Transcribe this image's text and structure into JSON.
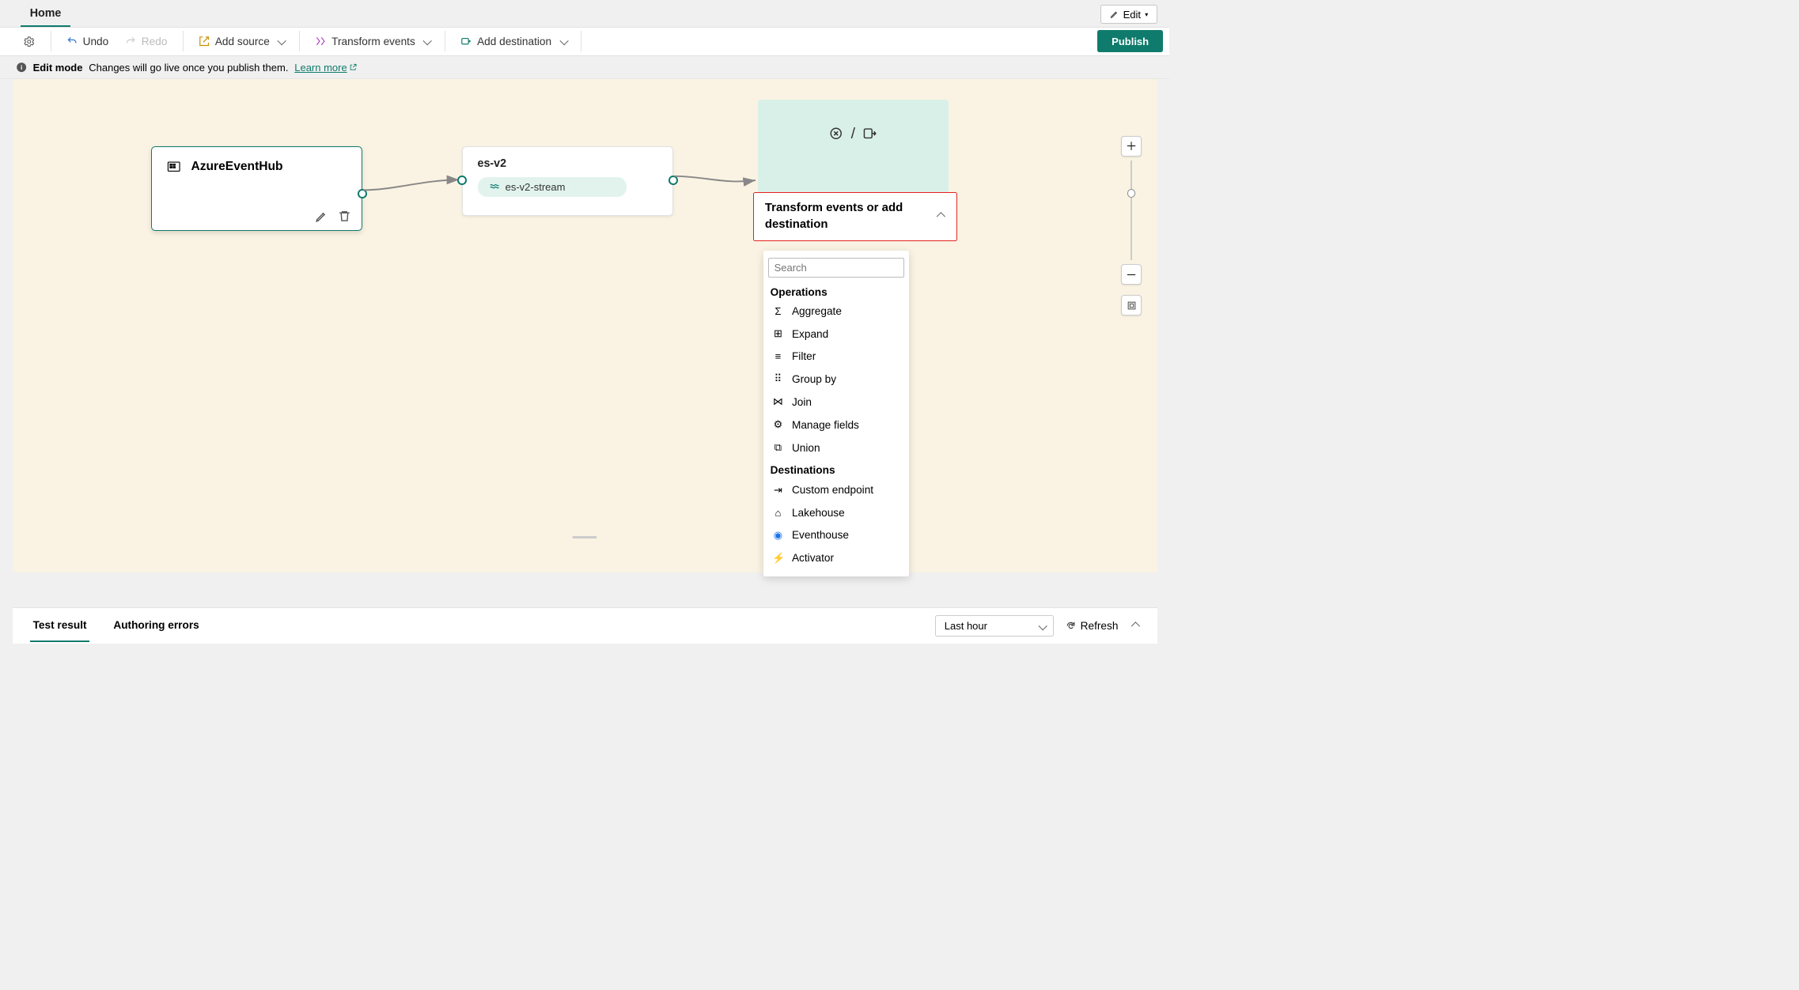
{
  "tabs": {
    "home": "Home"
  },
  "editBtn": "Edit",
  "toolbar": {
    "undo": "Undo",
    "redo": "Redo",
    "addSource": "Add source",
    "transform": "Transform events",
    "addDest": "Add destination",
    "publish": "Publish"
  },
  "info": {
    "mode": "Edit mode",
    "msg": "Changes will go live once you publish them.",
    "link": "Learn more"
  },
  "nodes": {
    "source": {
      "title": "AzureEventHub"
    },
    "mid": {
      "title": "es-v2",
      "stream": "es-v2-stream"
    }
  },
  "dropdown": {
    "title": "Transform events or add destination",
    "searchPlaceholder": "Search",
    "groups": {
      "ops": "Operations",
      "dest": "Destinations"
    },
    "ops": [
      "Aggregate",
      "Expand",
      "Filter",
      "Group by",
      "Join",
      "Manage fields",
      "Union"
    ],
    "dest": [
      "Custom endpoint",
      "Lakehouse",
      "Eventhouse",
      "Activator"
    ]
  },
  "footer": {
    "testResult": "Test result",
    "authErrors": "Authoring errors",
    "timeRange": "Last hour",
    "refresh": "Refresh"
  }
}
